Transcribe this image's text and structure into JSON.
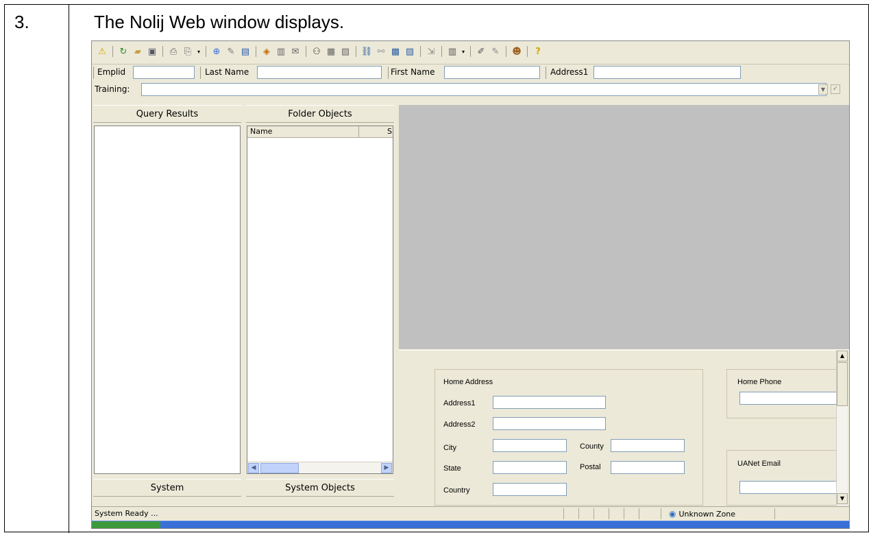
{
  "doc": {
    "step": "3.",
    "text": "The Nolij Web window displays."
  },
  "toolbar": {
    "icons": [
      "warning-icon",
      "refresh-icon",
      "open-folder-icon",
      "save-icon",
      "print-icon",
      "print-preview-icon",
      "zoom-icon",
      "edit-icon",
      "scan-icon",
      "route-icon",
      "batch-icon",
      "mail-icon",
      "binoculars-icon",
      "index-icon",
      "stack-icon",
      "link-icon",
      "workflow-icon",
      "group-icon",
      "view-icon",
      "export-icon",
      "columns-icon",
      "annotate-icon",
      "notes-icon",
      "user-help-icon",
      "help-icon"
    ]
  },
  "fields": {
    "emplid_label": "Emplid",
    "lastname_label": "Last Name",
    "firstname_label": "First Name",
    "address1_label": "Address1",
    "training_label": "Training:"
  },
  "panes": {
    "query_results": "Query Results",
    "folder_objects": "Folder Objects",
    "name_col": "Name",
    "s_col": "S",
    "system": "System",
    "system_objects": "System Objects"
  },
  "form": {
    "home_address": "Home Address",
    "address1": "Address1",
    "address2": "Address2",
    "city": "City",
    "county": "County",
    "state": "State",
    "postal": "Postal",
    "country": "Country",
    "home_phone": "Home Phone",
    "uanet_email": "UANet Email"
  },
  "status": {
    "text": "System Ready ...",
    "zone": "Unknown Zone"
  }
}
